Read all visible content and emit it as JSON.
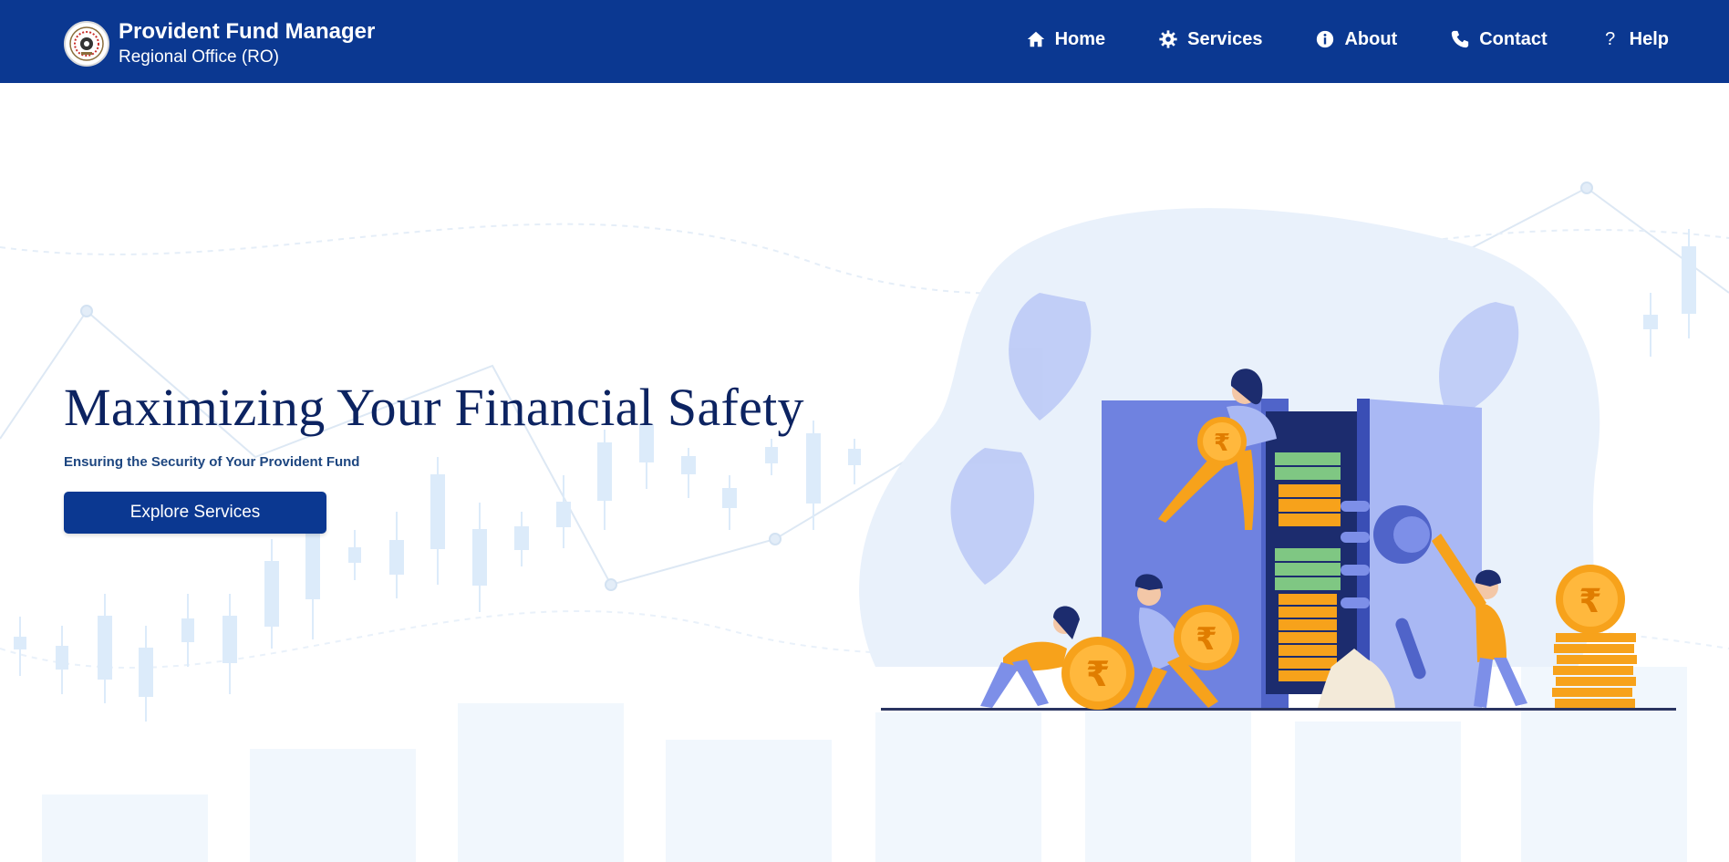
{
  "header": {
    "title": "Provident Fund Manager",
    "subtitle": "Regional Office (RO)",
    "brand_color": "#0b3891",
    "logo_icon": "emblem-logo"
  },
  "nav": {
    "items": [
      {
        "label": "Home",
        "icon": "home-icon"
      },
      {
        "label": "Services",
        "icon": "gear-icon"
      },
      {
        "label": "About",
        "icon": "info-icon"
      },
      {
        "label": "Contact",
        "icon": "phone-icon"
      },
      {
        "label": "Help",
        "icon": "question-icon"
      }
    ]
  },
  "hero": {
    "headline": "Maximizing Your Financial Safety",
    "subheadline": "Ensuring the Security of Your Provident Fund",
    "cta_label": "Explore Services",
    "coin_symbol": "₹",
    "illustration": "safe-vault-illustration"
  },
  "colors": {
    "headline": "#0c2361",
    "accent_orange": "#f7a21b",
    "safe_blue": "#6f82e0"
  }
}
